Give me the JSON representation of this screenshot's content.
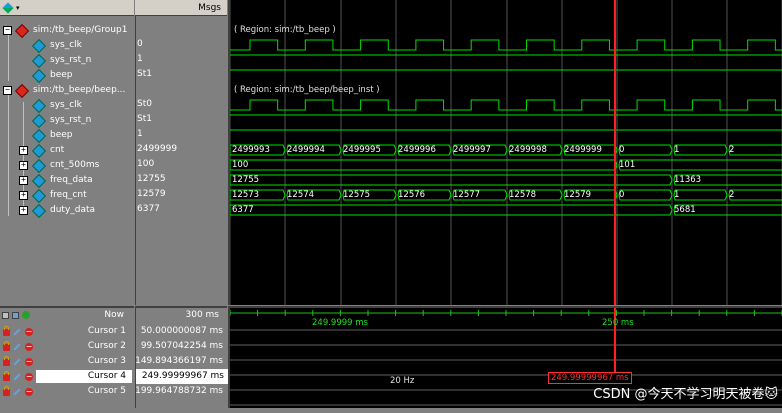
{
  "header": {
    "msgs_label": "Msgs"
  },
  "tree": [
    {
      "label": "sim:/tb_beep/Group1",
      "kind": "group",
      "value": ""
    },
    {
      "label": "sys_clk",
      "kind": "signal",
      "value": "0"
    },
    {
      "label": "sys_rst_n",
      "kind": "signal",
      "value": "1"
    },
    {
      "label": "beep",
      "kind": "signal",
      "value": "St1"
    },
    {
      "label": "sim:/tb_beep/beep...",
      "kind": "group",
      "value": ""
    },
    {
      "label": "sys_clk",
      "kind": "signal",
      "value": "St0"
    },
    {
      "label": "sys_rst_n",
      "kind": "signal",
      "value": "St1"
    },
    {
      "label": "beep",
      "kind": "signal",
      "value": "1"
    },
    {
      "label": "cnt",
      "kind": "bus",
      "value": "2499999"
    },
    {
      "label": "cnt_500ms",
      "kind": "bus",
      "value": "100"
    },
    {
      "label": "freq_data",
      "kind": "bus",
      "value": "12755"
    },
    {
      "label": "freq_cnt",
      "kind": "bus",
      "value": "12579"
    },
    {
      "label": "duty_data",
      "kind": "bus",
      "value": "6377"
    }
  ],
  "regions": {
    "group1": "( Region: sim:/tb_beep )",
    "inst": "( Region: sim:/tb_beep/beep_inst )"
  },
  "buses": {
    "cnt": [
      "2499993",
      "2499994",
      "2499995",
      "2499996",
      "2499997",
      "2499998",
      "2499999",
      "0",
      "1",
      "2"
    ],
    "cnt_500ms": [
      "100",
      "101"
    ],
    "freq_data": [
      "12755",
      "11363"
    ],
    "freq_cnt": [
      "12573",
      "12574",
      "12575",
      "12576",
      "12577",
      "12578",
      "12579",
      "0",
      "1",
      "2"
    ],
    "duty_data": [
      "6377",
      "5681"
    ]
  },
  "cursor_panel": {
    "now_label": "Now",
    "now_value": "300 ms",
    "cursors": [
      {
        "label": "Cursor 1",
        "value": "50.000000087 ms"
      },
      {
        "label": "Cursor 2",
        "value": "99.507042254 ms"
      },
      {
        "label": "Cursor 3",
        "value": "149.894366197 ms"
      },
      {
        "label": "Cursor 4",
        "value": "249.99999967 ms",
        "selected": true
      },
      {
        "label": "Cursor 5",
        "value": "199.964788732 ms"
      }
    ],
    "timeline_left": "249.9999 ms",
    "timeline_right": "250 ms",
    "delta_label": "20 Hz",
    "cursor_tag": "249.99999967 ms"
  },
  "watermark": "CSDN @今天不学习明天被卷🐱",
  "colors": {
    "wave": "#00e000",
    "cursor": "#ff2020",
    "background": "#000000"
  }
}
